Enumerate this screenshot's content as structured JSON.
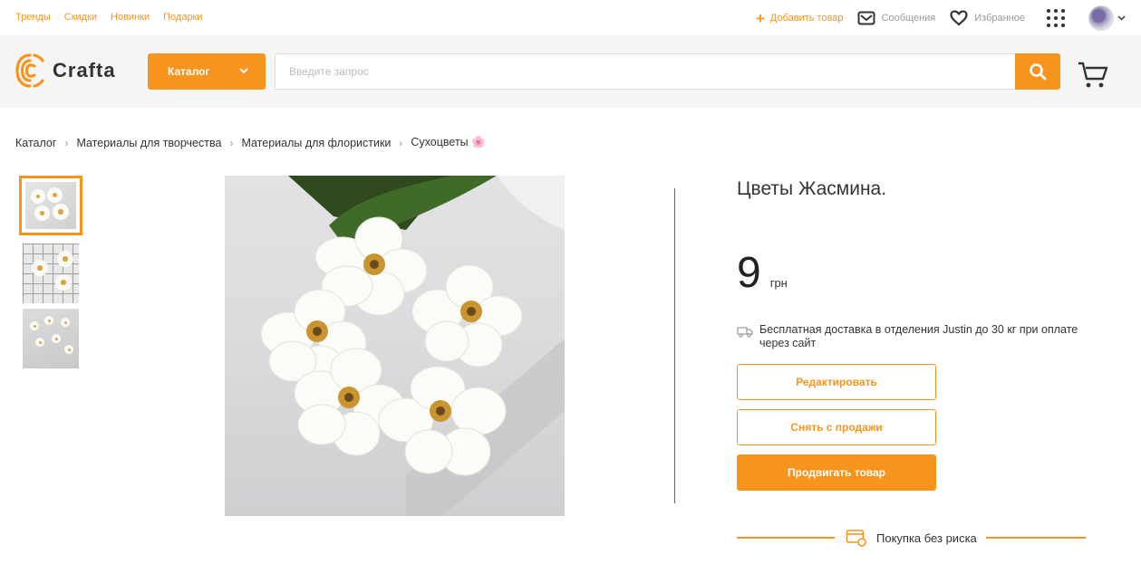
{
  "top_nav": {
    "links": [
      "Тренды",
      "Скидки",
      "Новинки",
      "Подарки"
    ],
    "add_item": "Добавить товар",
    "messages": "Сообщения",
    "favorites": "Избранное"
  },
  "header": {
    "logo": "Crafta",
    "catalog_button": "Каталог",
    "search_placeholder": "Введите запрос"
  },
  "breadcrumb": [
    "Каталог",
    "Материалы для творчества",
    "Материалы для флористики",
    "Сухоцветы 🌸"
  ],
  "product": {
    "title": "Цветы Жасмина.",
    "price": "9",
    "currency": "грн",
    "delivery": "Бесплатная доставка в отделения Justin до 30 кг при оплате через сайт",
    "edit_button": "Редактировать",
    "unpublish_button": "Снять с продажи",
    "promote_button": "Продвигать товар",
    "risk_free": "Покупка без риска"
  },
  "colors": {
    "accent": "#f7941d",
    "header_bg": "#f5f5f5",
    "text": "#333333"
  },
  "icons": [
    "plus-icon",
    "envelope-icon",
    "heart-icon",
    "grid-menu-icon",
    "avatar",
    "chevron-down-icon",
    "search-icon",
    "cart-icon",
    "delivery-truck-icon",
    "shield-card-icon"
  ]
}
